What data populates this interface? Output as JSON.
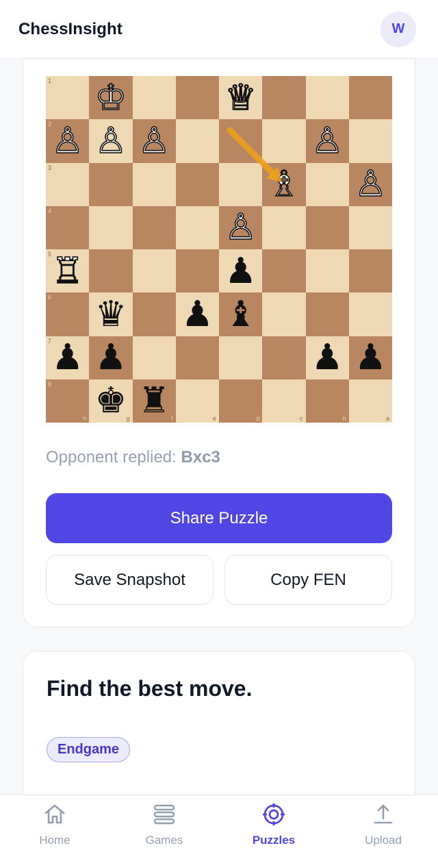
{
  "header": {
    "brand": "ChessInsight",
    "avatar_initial": "W"
  },
  "board": {
    "orientation": "black-bottom",
    "rank_labels": [
      "1",
      "2",
      "3",
      "4",
      "5",
      "6",
      "7",
      "8"
    ],
    "file_labels": [
      "h",
      "g",
      "f",
      "e",
      "d",
      "c",
      "b",
      "a"
    ],
    "light_color": "#efd9b5",
    "dark_color": "#b88762",
    "pieces": [
      {
        "square": "g1",
        "color": "white",
        "type": "king"
      },
      {
        "square": "d1",
        "color": "white",
        "type": "queen"
      },
      {
        "square": "h2",
        "color": "white",
        "type": "pawn"
      },
      {
        "square": "g2",
        "color": "white",
        "type": "pawn"
      },
      {
        "square": "f2",
        "color": "white",
        "type": "pawn"
      },
      {
        "square": "b2",
        "color": "white",
        "type": "pawn"
      },
      {
        "square": "c3",
        "color": "white",
        "type": "bishop"
      },
      {
        "square": "a3",
        "color": "white",
        "type": "pawn"
      },
      {
        "square": "d4",
        "color": "white",
        "type": "pawn"
      },
      {
        "square": "h5",
        "color": "white",
        "type": "rook"
      },
      {
        "square": "d5",
        "color": "black",
        "type": "pawn"
      },
      {
        "square": "g6",
        "color": "black",
        "type": "queen"
      },
      {
        "square": "e6",
        "color": "black",
        "type": "pawn"
      },
      {
        "square": "d6",
        "color": "black",
        "type": "bishop"
      },
      {
        "square": "h7",
        "color": "black",
        "type": "pawn"
      },
      {
        "square": "g7",
        "color": "black",
        "type": "pawn"
      },
      {
        "square": "b7",
        "color": "black",
        "type": "pawn"
      },
      {
        "square": "a7",
        "color": "black",
        "type": "pawn"
      },
      {
        "square": "g8",
        "color": "black",
        "type": "king"
      },
      {
        "square": "f8",
        "color": "black",
        "type": "rook"
      }
    ],
    "last_move_arrow": {
      "from": "d2",
      "to": "c3",
      "color": "#f0a21a"
    }
  },
  "reply": {
    "prefix": "Opponent replied: ",
    "move": "Bxc3"
  },
  "actions": {
    "share_label": "Share Puzzle",
    "save_label": "Save Snapshot",
    "copy_label": "Copy FEN",
    "accent": "#5046e5"
  },
  "puzzle": {
    "title": "Find the best move.",
    "tag": "Endgame"
  },
  "nav": {
    "items": [
      {
        "label": "Home",
        "icon": "home-icon"
      },
      {
        "label": "Games",
        "icon": "stack-icon"
      },
      {
        "label": "Puzzles",
        "icon": "target-icon",
        "active": true
      },
      {
        "label": "Upload",
        "icon": "upload-icon"
      }
    ]
  }
}
